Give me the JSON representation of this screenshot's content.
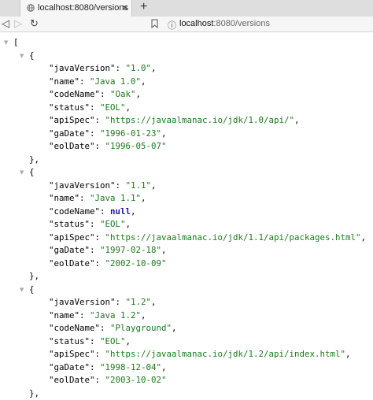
{
  "browser": {
    "tab_title": "localhost:8080/versions",
    "close_glyph": "×",
    "newtab_glyph": "+",
    "url_host": "localhost",
    "url_path": ":8080/versions",
    "back_glyph": "◁",
    "forward_glyph": "▷",
    "reload_glyph": "↻",
    "bookmark_glyph": "⊿",
    "info_glyph": "ⓘ"
  },
  "json_view": {
    "open_bracket": "[",
    "versions": [
      {
        "javaVersion": "\"1.0\"",
        "name": "\"Java 1.0\"",
        "codeName": "\"Oak\"",
        "status": "\"EOL\"",
        "apiSpec": "\"https://javaalmanac.io/jdk/1.0/api/\"",
        "gaDate": "\"1996-01-23\"",
        "eolDate": "\"1996-05-07\""
      },
      {
        "javaVersion": "\"1.1\"",
        "name": "\"Java 1.1\"",
        "codeName": "null",
        "status": "\"EOL\"",
        "apiSpec": "\"https://javaalmanac.io/jdk/1.1/api/packages.html\"",
        "gaDate": "\"1997-02-18\"",
        "eolDate": "\"2002-10-09\""
      },
      {
        "javaVersion": "\"1.2\"",
        "name": "\"Java 1.2\"",
        "codeName": "\"Playground\"",
        "status": "\"EOL\"",
        "apiSpec": "\"https://javaalmanac.io/jdk/1.2/api/index.html\"",
        "gaDate": "\"1998-12-04\"",
        "eolDate": "\"2003-10-02\""
      }
    ]
  }
}
